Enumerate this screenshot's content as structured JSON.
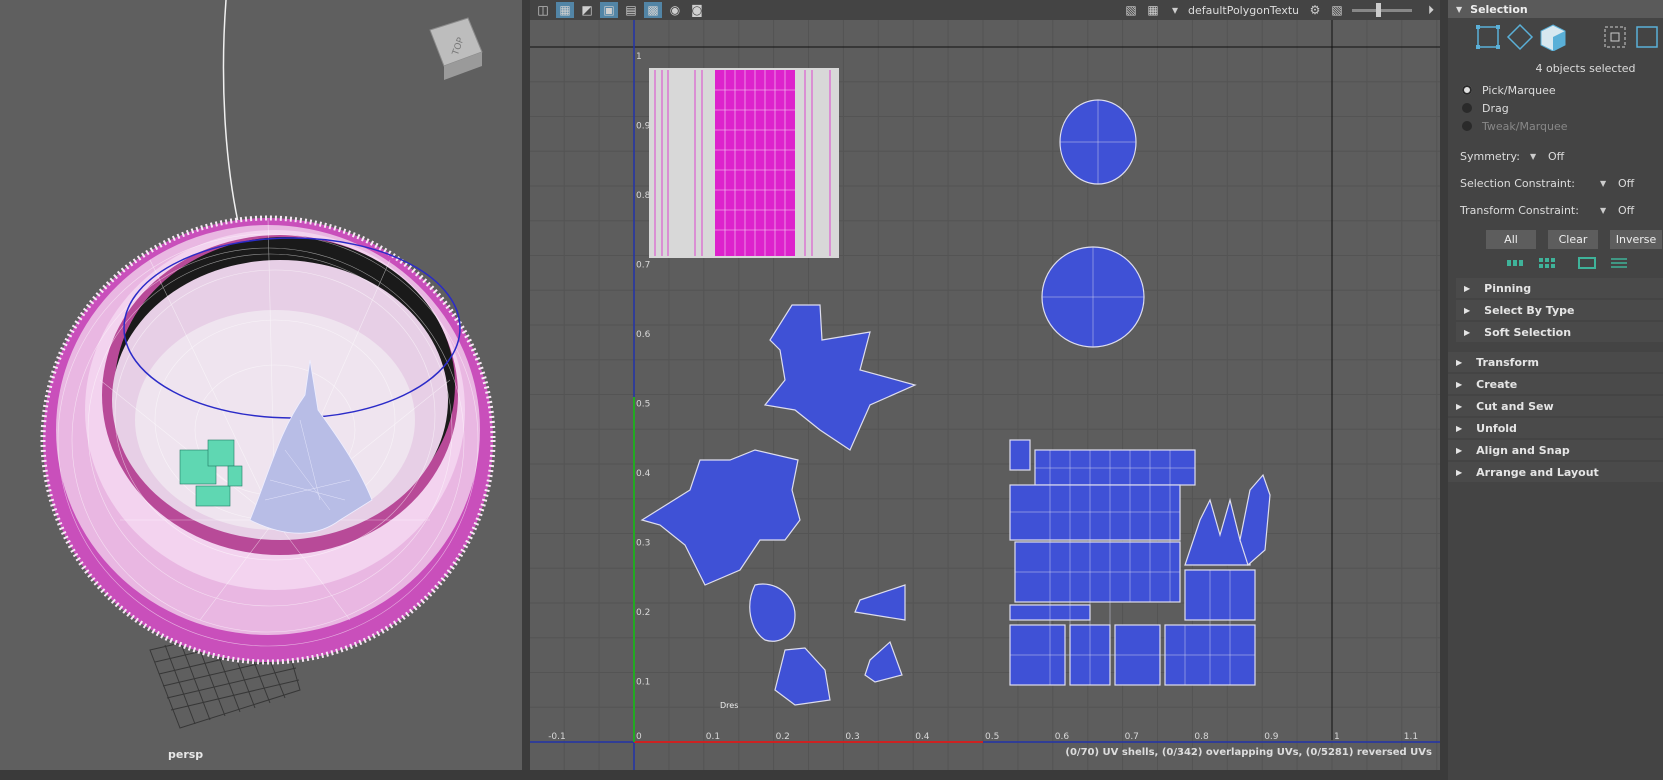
{
  "viewport": {
    "camera_label": "persp",
    "view_cube_label": "TOP"
  },
  "uv_editor": {
    "texture_name": "defaultPolygonTexture",
    "status_text": "(0/70) UV shells, (0/342) overlapping UVs, (0/5281) reversed UVs",
    "x_ticks": [
      "-0.1",
      "0",
      "0.1",
      "0.2",
      "0.3",
      "0.4",
      "0.5",
      "0.6",
      "0.7",
      "0.8",
      "0.9",
      "1",
      "1.1"
    ],
    "y_ticks": [
      "1",
      "0.9",
      "0.8",
      "0.7",
      "0.6",
      "0.5",
      "0.4",
      "0.3",
      "0.2",
      "0.1"
    ],
    "toolbar_icons": [
      "grid-icon",
      "uv-snapshot-icon",
      "checker-icon",
      "isolate-icon",
      "display-image-icon",
      "pixel-snap-icon",
      "shaded-uv-icon",
      "render-icon"
    ],
    "colors": {
      "shell_fill": "#3f51d6",
      "shell_stroke": "#dcdcff",
      "magenta": "#dd22cc",
      "u_axis": "#cc2222",
      "v_axis": "#22aa22"
    }
  },
  "panel": {
    "section_title": "Selection",
    "objects_selected": "4 objects selected",
    "modes": [
      {
        "label": "Pick/Marquee",
        "selected": true,
        "enabled": true
      },
      {
        "label": "Drag",
        "selected": false,
        "enabled": true
      },
      {
        "label": "Tweak/Marquee",
        "selected": false,
        "enabled": false
      }
    ],
    "options": [
      {
        "label": "Symmetry:",
        "value": "Off"
      },
      {
        "label": "Selection Constraint:",
        "value": "Off"
      },
      {
        "label": "Transform Constraint:",
        "value": "Off"
      }
    ],
    "buttons": {
      "all": "All",
      "clear": "Clear",
      "inverse": "Inverse"
    },
    "sub_sections": [
      "Pinning",
      "Select By Type",
      "Soft Selection"
    ],
    "main_sections": [
      "Transform",
      "Create",
      "Cut and Sew",
      "Unfold",
      "Align and Snap",
      "Arrange and Layout"
    ]
  }
}
